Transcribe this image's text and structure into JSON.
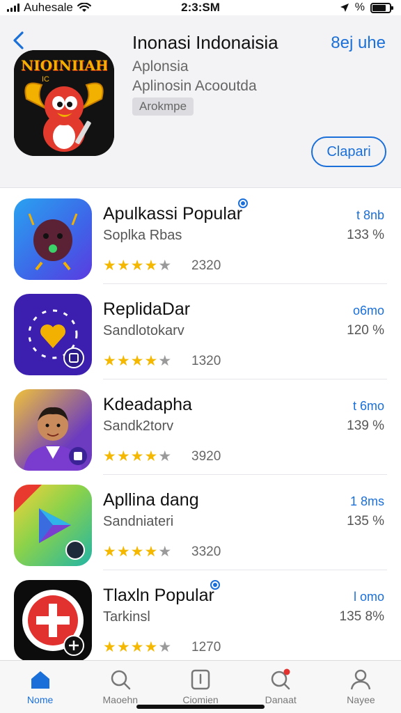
{
  "status_bar": {
    "carrier": "Auhesale",
    "time": "2:3:SM",
    "battery": "%"
  },
  "header": {
    "back_icon": "chevron-left-icon",
    "title": "Inonasi Indonaisia",
    "link": "8ej uhe",
    "subtitle1": "Aplonsia",
    "subtitle2": "Aplinosin Acooutda",
    "tag": "Arokmpe",
    "button_label": "Clapari",
    "accent_color": "#1a6fd8",
    "hero_icon_text": "NIOINIIAH",
    "hero_icon_subtext": "IC"
  },
  "apps": [
    {
      "title": "Apulkassi Popular",
      "subtitle": "Soplka Rbas",
      "rating_stars": 4,
      "rating_count": "2320",
      "size": "t 8nb",
      "percent": "133 %",
      "has_badge": true,
      "icon": "beetle-character-icon"
    },
    {
      "title": "ReplidaDar",
      "subtitle": "Sandlotokarv",
      "rating_stars": 4,
      "rating_count": "1320",
      "size": "o6mo",
      "percent": "120 %",
      "has_badge": false,
      "icon": "heart-dots-icon"
    },
    {
      "title": "Kdeadapha",
      "subtitle": "Sandk2torv",
      "rating_stars": 4,
      "rating_count": "3920",
      "size": "t 6mo",
      "percent": "139 %",
      "has_badge": false,
      "icon": "avatar-man-icon"
    },
    {
      "title": "Apllina dang",
      "subtitle": "Sandniateri",
      "rating_stars": 4,
      "rating_count": "3320",
      "size": "1 8ms",
      "percent": "135 %",
      "has_badge": false,
      "icon": "play-triangle-icon"
    },
    {
      "title": "Tlaxln Popular",
      "subtitle": "Tarkinsl",
      "rating_stars": 4,
      "rating_count": "1270",
      "size": "l omo",
      "percent": "135 8%",
      "has_badge": true,
      "icon": "red-cross-icon"
    }
  ],
  "tabs": [
    {
      "label": "Nome",
      "icon": "home-icon"
    },
    {
      "label": "Maoehn",
      "icon": "search-icon"
    },
    {
      "label": "Ciomien",
      "icon": "info-box-icon"
    },
    {
      "label": "Danaat",
      "icon": "search-notify-icon"
    },
    {
      "label": "Nayee",
      "icon": "person-icon"
    }
  ]
}
